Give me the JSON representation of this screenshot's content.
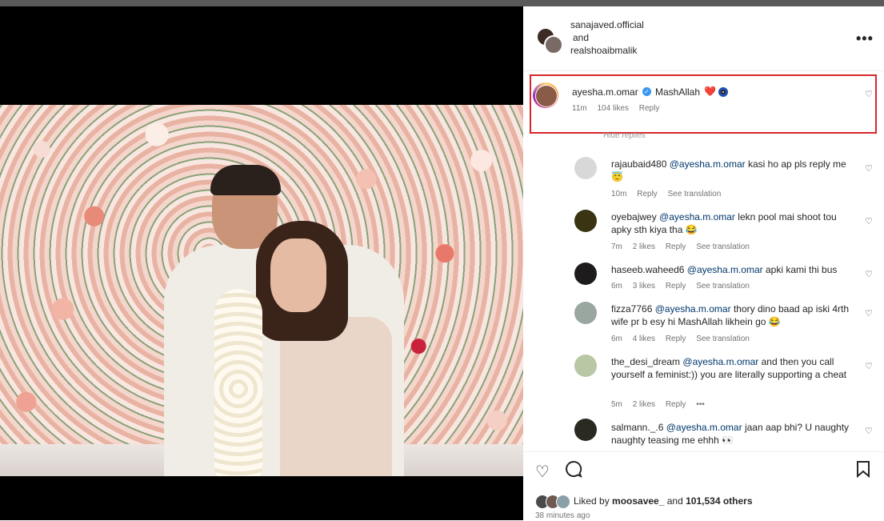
{
  "header": {
    "user1": "sanajaved.official",
    "and": "and",
    "user2": "realshoaibmalik",
    "more": "•••"
  },
  "main_comment": {
    "user": "ayesha.m.omar",
    "text": "MashAllah",
    "emoji": "❤️",
    "time": "11m",
    "likes": "104 likes",
    "reply": "Reply",
    "hide_replies": "Hide replies"
  },
  "replies": [
    {
      "user": "rajaubaid480",
      "mention": "@ayesha.m.omar",
      "text": " kasi ho ap pls reply me 😇",
      "time": "10m",
      "likes": "",
      "reply": "Reply",
      "translate": "See translation",
      "avatar_color": "#d8d8d8"
    },
    {
      "user": "oyebajwey",
      "mention": "@ayesha.m.omar",
      "text": " lekn pool mai shoot tou apky sth kiya tha 😂",
      "time": "7m",
      "likes": "2 likes",
      "reply": "Reply",
      "translate": "See translation",
      "avatar_color": "#3a3412"
    },
    {
      "user": "haseeb.waheed6",
      "mention": "@ayesha.m.omar",
      "text": " apki kami thi bus",
      "time": "6m",
      "likes": "3 likes",
      "reply": "Reply",
      "translate": "See translation",
      "avatar_color": "#1e1b1c"
    },
    {
      "user": "fizza7766",
      "mention": "@ayesha.m.omar",
      "text": " thory dino baad ap iski 4rth wife pr b esy hi MashAllah likhein go 😂",
      "time": "6m",
      "likes": "4 likes",
      "reply": "Reply",
      "translate": "See translation",
      "avatar_color": "#9aa6a0"
    },
    {
      "user": "the_desi_dream",
      "mention": "@ayesha.m.omar",
      "text": " and then you call yourself a feminist:)) you are literally supporting a cheat",
      "time": "5m",
      "likes": "2 likes",
      "reply": "Reply",
      "translate": "•••",
      "avatar_color": "#b8c7a4"
    },
    {
      "user": "salmann._.6",
      "mention": "@ayesha.m.omar",
      "text": " jaan aap bhi? U naughty naughty teasing me ehhh 👀",
      "time": "",
      "likes": "",
      "reply": "",
      "translate": "",
      "avatar_color": "#2b2a20"
    }
  ],
  "footer": {
    "liked_by_prefix": "Liked by ",
    "liked_user": "moosavee_",
    "liked_and": " and ",
    "others": "101,534 others",
    "time_ago": "38 minutes ago"
  },
  "colors": {
    "highlight": "#d9262a",
    "mention": "#00376b",
    "muted": "#737373"
  }
}
